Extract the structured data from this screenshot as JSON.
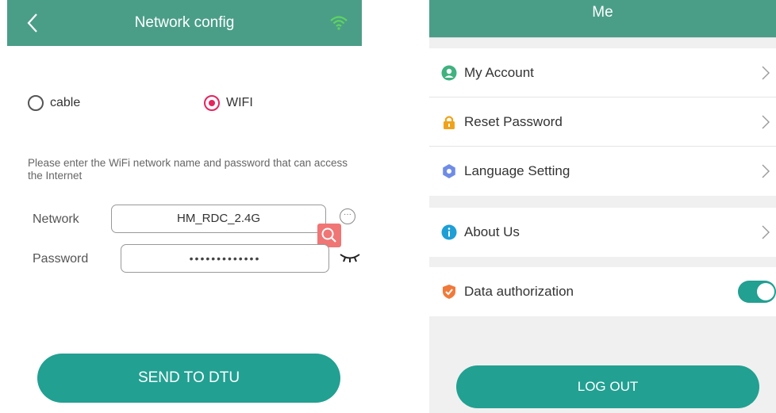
{
  "network_config": {
    "title": "Network config",
    "connection_options": [
      {
        "label": "cable",
        "selected": false
      },
      {
        "label": "WIFI",
        "selected": true
      }
    ],
    "hint": "Please enter the WiFi network name and password that can access the Internet",
    "network_label": "Network",
    "network_value": "HM_RDC_2.4G",
    "password_label": "Password",
    "password_value": "•••••••••••••",
    "more_glyph": "···",
    "send_button": "SEND TO DTU",
    "colors": {
      "header": "#4a9e88",
      "button": "#22a092",
      "radio_selected": "#e6245d",
      "search": "#f07575"
    }
  },
  "me": {
    "title": "Me",
    "menu_group_1": [
      {
        "label": "My Account",
        "icon": "user-icon"
      },
      {
        "label": "Reset Password",
        "icon": "lock-icon"
      },
      {
        "label": "Language Setting",
        "icon": "gear-icon"
      }
    ],
    "menu_group_2": [
      {
        "label": "About Us",
        "icon": "info-icon"
      }
    ],
    "menu_group_3": [
      {
        "label": "Data authorization",
        "icon": "shield-icon",
        "toggle_on": true
      }
    ],
    "logout_button": "LOG OUT"
  }
}
